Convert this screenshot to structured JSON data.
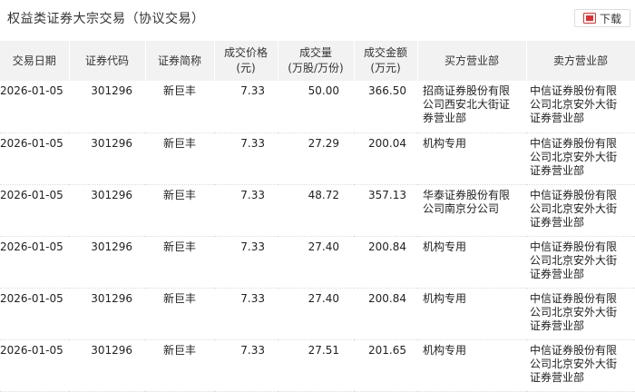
{
  "page": {
    "title": "权益类证券大宗交易（协议交易）",
    "download_label": "下载"
  },
  "table": {
    "headers": [
      "交易日期",
      "证券代码",
      "证券简称",
      "成交价格\n(元)",
      "成交量\n(万股/万份)",
      "成交金额\n(万元)",
      "买方营业部",
      "卖方营业部"
    ],
    "rows": [
      {
        "date": "2026-01-05",
        "code": "301296",
        "name": "新巨丰",
        "price": "7.33",
        "volume": "50.00",
        "amount": "366.50",
        "buyer": "招商证券股份有限公司西安北大街证券营业部",
        "seller": "中信证券股份有限公司北京安外大街证券营业部"
      },
      {
        "date": "2026-01-05",
        "code": "301296",
        "name": "新巨丰",
        "price": "7.33",
        "volume": "27.29",
        "amount": "200.04",
        "buyer": "机构专用",
        "seller": "中信证券股份有限公司北京安外大街证券营业部"
      },
      {
        "date": "2026-01-05",
        "code": "301296",
        "name": "新巨丰",
        "price": "7.33",
        "volume": "48.72",
        "amount": "357.13",
        "buyer": "华泰证券股份有限公司南京分公司",
        "seller": "中信证券股份有限公司北京安外大街证券营业部"
      },
      {
        "date": "2026-01-05",
        "code": "301296",
        "name": "新巨丰",
        "price": "7.33",
        "volume": "27.40",
        "amount": "200.84",
        "buyer": "机构专用",
        "seller": "中信证券股份有限公司北京安外大街证券营业部"
      },
      {
        "date": "2026-01-05",
        "code": "301296",
        "name": "新巨丰",
        "price": "7.33",
        "volume": "27.40",
        "amount": "200.84",
        "buyer": "机构专用",
        "seller": "中信证券股份有限公司北京安外大街证券营业部"
      },
      {
        "date": "2026-01-05",
        "code": "301296",
        "name": "新巨丰",
        "price": "7.33",
        "volume": "27.51",
        "amount": "201.65",
        "buyer": "机构专用",
        "seller": "中信证券股份有限公司北京安外大街证券营业部"
      }
    ]
  },
  "colors": {
    "header_bg": "#f2f2f2",
    "download_icon": "#e03030"
  },
  "icons": {
    "download": "download-icon"
  }
}
